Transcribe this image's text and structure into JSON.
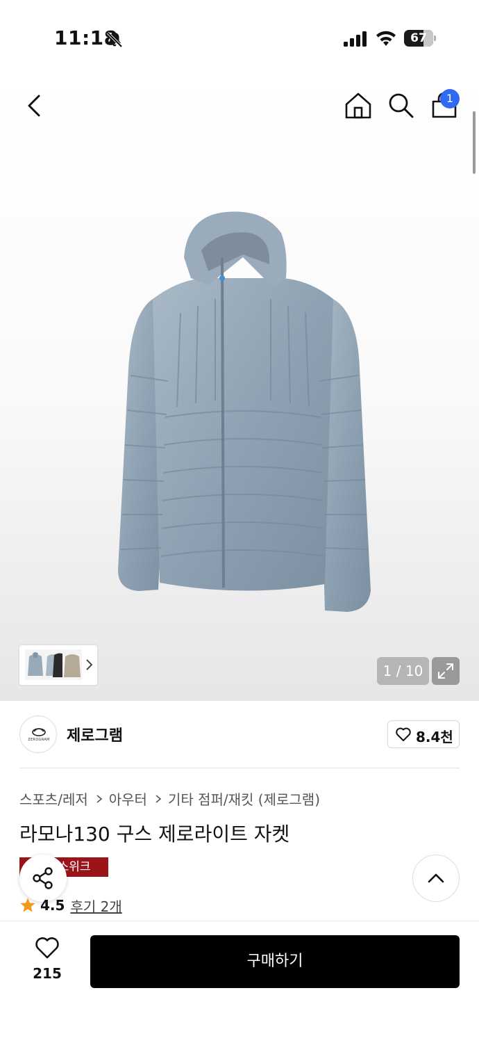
{
  "status_bar": {
    "time": "11:18",
    "battery_level": "67",
    "battery_fraction": 0.67,
    "icons": [
      "bell-off-icon",
      "signal-icon",
      "wifi-icon",
      "battery-icon"
    ]
  },
  "nav": {
    "icons": [
      "chevron-left-icon",
      "home-icon",
      "search-icon",
      "shopping-bag-icon"
    ],
    "cart_count": "1",
    "badge_color": "#2f6bf2"
  },
  "gallery": {
    "image": "blue-gray-down-hooded-jacket",
    "page_counter": "1 / 10",
    "thumbnails": [
      "jacket-blue-gray",
      "jacket-black",
      "jacket-beige"
    ],
    "icons": [
      "chevron-right-icon",
      "expand-icon"
    ]
  },
  "brand": {
    "logo_text": "ZEROGRAM",
    "name": "제로그램",
    "likes": "8.4천"
  },
  "product": {
    "breadcrumb": [
      "스포츠/레저",
      "아우터",
      "기타 점퍼/재킷 (제로그램)"
    ],
    "title": "라모나130 구스 제로라이트 자켓",
    "promo_badge": "런스위크",
    "promo_color": "#9b1419",
    "rating": "4.5",
    "reviews": "후기 2개"
  },
  "bottom_bar": {
    "wish_count": "215",
    "buy_label": "구매하기"
  }
}
